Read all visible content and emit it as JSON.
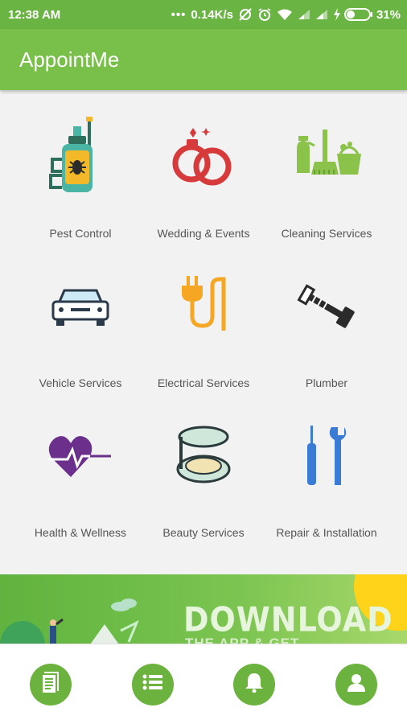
{
  "status": {
    "time": "12:38 AM",
    "speed": "0.14K/s",
    "battery": "31%"
  },
  "app": {
    "title": "AppointMe"
  },
  "services": [
    {
      "label": "Pest Control",
      "icon": "pest-sprayer-icon"
    },
    {
      "label": "Wedding & Events",
      "icon": "wedding-rings-icon"
    },
    {
      "label": "Cleaning Services",
      "icon": "cleaning-supplies-icon"
    },
    {
      "label": "Vehicle Services",
      "icon": "car-icon"
    },
    {
      "label": "Electrical Services",
      "icon": "electric-plug-icon"
    },
    {
      "label": "Plumber",
      "icon": "pipe-wrench-icon"
    },
    {
      "label": "Health & Wellness",
      "icon": "heart-pulse-icon"
    },
    {
      "label": "Beauty Services",
      "icon": "compact-powder-icon"
    },
    {
      "label": "Repair & Installation",
      "icon": "screwdriver-wrench-icon"
    }
  ],
  "banner": {
    "title": "DOWNLOAD",
    "subtitle": "THE APP & GET"
  },
  "bottom_nav": [
    {
      "icon": "document-icon"
    },
    {
      "icon": "list-icon"
    },
    {
      "icon": "bell-icon"
    },
    {
      "icon": "user-icon"
    }
  ],
  "colors": {
    "status_bar": "#6ab443",
    "app_bar": "#79c04a",
    "nav_button": "#6cb23f",
    "background": "#f2f2f2"
  }
}
